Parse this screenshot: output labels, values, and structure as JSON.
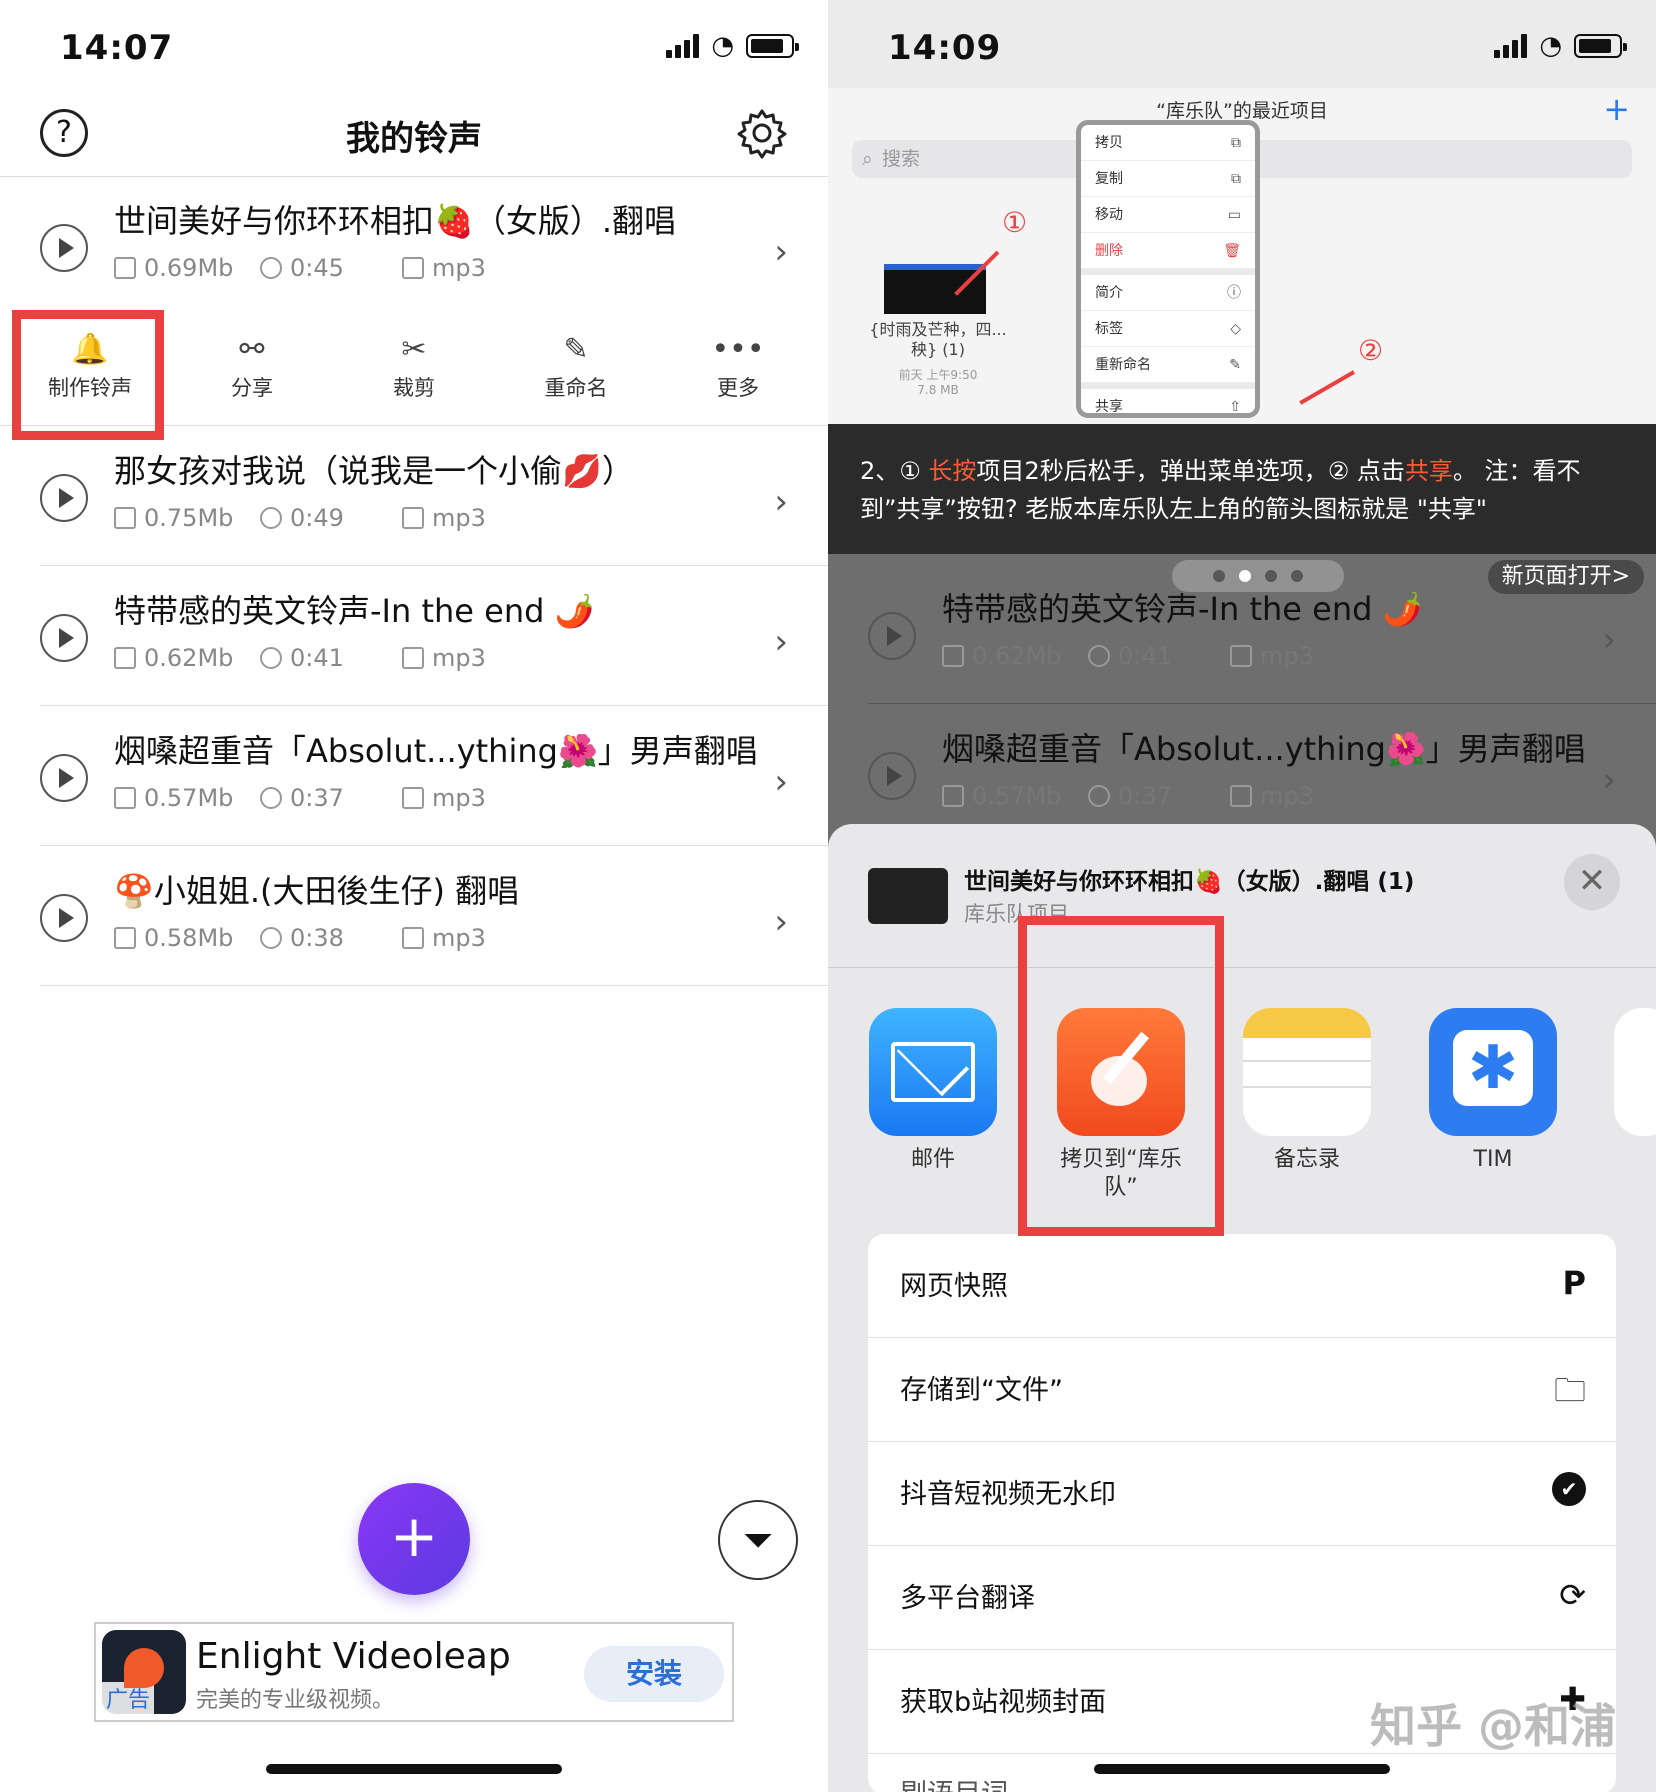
{
  "left": {
    "time": "14:07",
    "nav_title": "我的铃声",
    "help_glyph": "?",
    "rows": [
      {
        "title": "世间美好与你环环相扣🍓（女版）.翻唱",
        "size": "0.69Mb",
        "dur": "0:45",
        "fmt": "mp3"
      },
      {
        "title": "那女孩对我说（说我是一个小偷💋）",
        "size": "0.75Mb",
        "dur": "0:49",
        "fmt": "mp3"
      },
      {
        "title": "特带感的英文铃声-In the end 🌶️",
        "size": "0.62Mb",
        "dur": "0:41",
        "fmt": "mp3"
      },
      {
        "title": "烟嗓超重音「Absolut...ything🌺」男声翻唱",
        "size": "0.57Mb",
        "dur": "0:37",
        "fmt": "mp3"
      },
      {
        "title": "🍄小姐姐.(大田後生仔) 翻唱",
        "size": "0.58Mb",
        "dur": "0:38",
        "fmt": "mp3"
      }
    ],
    "actions": [
      {
        "label": "制作铃声",
        "icon": "bell-icon",
        "glyph": "🔔"
      },
      {
        "label": "分享",
        "icon": "share-nodes-icon",
        "glyph": "⚯"
      },
      {
        "label": "裁剪",
        "icon": "scissors-icon",
        "glyph": "✂"
      },
      {
        "label": "重命名",
        "icon": "edit-icon",
        "glyph": "✎"
      },
      {
        "label": "更多",
        "icon": "more-icon",
        "glyph": "•••"
      }
    ],
    "fab": "+",
    "filter_glyph": "⏷",
    "ad": {
      "name": "Enlight Videoleap",
      "sub": "完美的专业级视频。",
      "tag": "广告",
      "button": "安装"
    }
  },
  "right": {
    "time": "14:09",
    "files_title": "“库乐队”的最近项目",
    "plus": "+",
    "search_placeholder": "搜索",
    "thumb_name": "{时雨及芒种，四...秧} (1)",
    "thumb_sub": "前天 上午9:50",
    "thumb_size": "7.8 MB",
    "menu": [
      "拷贝",
      "复制",
      "移动",
      "删除",
      "简介",
      "标签",
      "重新命名",
      "共享"
    ],
    "marker1": "①",
    "marker2": "②",
    "caption_a": "2、① ",
    "caption_hl1": "长按",
    "caption_b": "项目2秒后松手，弹出菜单选项，② 点击",
    "caption_hl2": "共享",
    "caption_c": "。 注：看不到”共享”按钮? 老版本库乐队左上角的箭头图标就是 \"共享\"",
    "new_page": "新页面打开>",
    "rows": [
      {
        "title": "特带感的英文铃声-In the end 🌶️",
        "size": "0.62Mb",
        "dur": "0:41",
        "fmt": "mp3"
      },
      {
        "title": "烟嗓超重音「Absolut...ything🌺」男声翻唱",
        "size": "0.57Mb",
        "dur": "0:37",
        "fmt": "mp3"
      }
    ],
    "share": {
      "title": "世间美好与你环环相扣🍓（女版）.翻唱 (1)",
      "subtitle": "库乐队项目",
      "close": "✕",
      "apps": [
        "邮件",
        "拷贝到“库乐队”",
        "备忘录",
        "TIM"
      ],
      "list": [
        {
          "label": "网页快照",
          "glyph": "P"
        },
        {
          "label": "存储到“文件”",
          "glyph": "🗀"
        },
        {
          "label": "抖音短视频无水印",
          "glyph": "✔"
        },
        {
          "label": "多平台翻译",
          "glyph": "⟳"
        },
        {
          "label": "获取b站视频封面",
          "glyph": "✚"
        },
        {
          "label": "剔语目词",
          "glyph": ""
        }
      ]
    },
    "watermark": "知乎 @和浦"
  },
  "colors": {
    "highlight_box": "#e8413f",
    "fab": "#7a37f0",
    "accent": "#2b7ce9"
  }
}
